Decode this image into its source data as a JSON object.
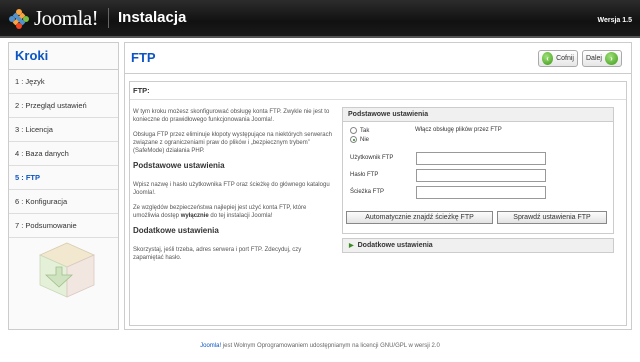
{
  "header": {
    "logo_text": "Joomla!",
    "title": "Instalacja",
    "version": "Wersja 1.5"
  },
  "sidebar": {
    "title": "Kroki",
    "steps": [
      {
        "label": "1 : Język",
        "active": false
      },
      {
        "label": "2 : Przegląd ustawień",
        "active": false
      },
      {
        "label": "3 : Licencja",
        "active": false
      },
      {
        "label": "4 : Baza danych",
        "active": false
      },
      {
        "label": "5 : FTP",
        "active": true
      },
      {
        "label": "6 : Konfiguracja",
        "active": false
      },
      {
        "label": "7 : Podsumowanie",
        "active": false
      }
    ]
  },
  "main": {
    "title": "FTP",
    "back_label": "Cofnij",
    "next_label": "Dalej",
    "subtitle": "FTP:",
    "intro_text": "W tym kroku możesz skonfigurować obsługę konta FTP. Zwykle nie jest to konieczne do prawidłowego funkcjonowania Joomla!.",
    "intro_text2": "Obsługa FTP przez eliminuje kłopoty występujące na niektórych serwerach związane z ograniczeniami praw do plików i „bezpiecznym trybem” (SafeMode) działania PHP.",
    "basic_heading": "Podstawowe ustawienia",
    "basic_text": "Wpisz nazwę i hasło użytkownika FTP oraz ścieżkę do głównego katalogu Joomla!.",
    "security_text_pre": "Ze względów bezpieczeństwa najlepiej jest użyć konta FTP, które umożliwia dostęp ",
    "security_text_bold": "wyłącznie",
    "security_text_post": " do tej instalacji Joomla!",
    "advanced_heading": "Dodatkowe ustawienia",
    "advanced_text": "Skorzystaj, jeśli trzeba, adres serwera i port FTP. Zdecyduj, czy zapamiętać hasło."
  },
  "panel": {
    "heading": "Podstawowe ustawienia",
    "radio_yes": "Tak",
    "radio_no": "Nie",
    "selected": "Nie",
    "enable_label": "Włącz obsługę plików przez FTP",
    "user_label": "Użytkownik FTP",
    "pass_label": "Hasło FTP",
    "path_label": "Ścieżka FTP",
    "user_value": "",
    "pass_value": "",
    "path_value": "",
    "auto_button": "Automatycznie znajdź ścieżkę FTP",
    "check_button": "Sprawdź ustawienia FTP",
    "advanced_label": "Dodatkowe ustawienia"
  },
  "footer": {
    "link": "Joomla!",
    "text": " jest Wolnym Oprogramowaniem udostępnianym na licencji GNU/GPL w wersji 2.0"
  }
}
